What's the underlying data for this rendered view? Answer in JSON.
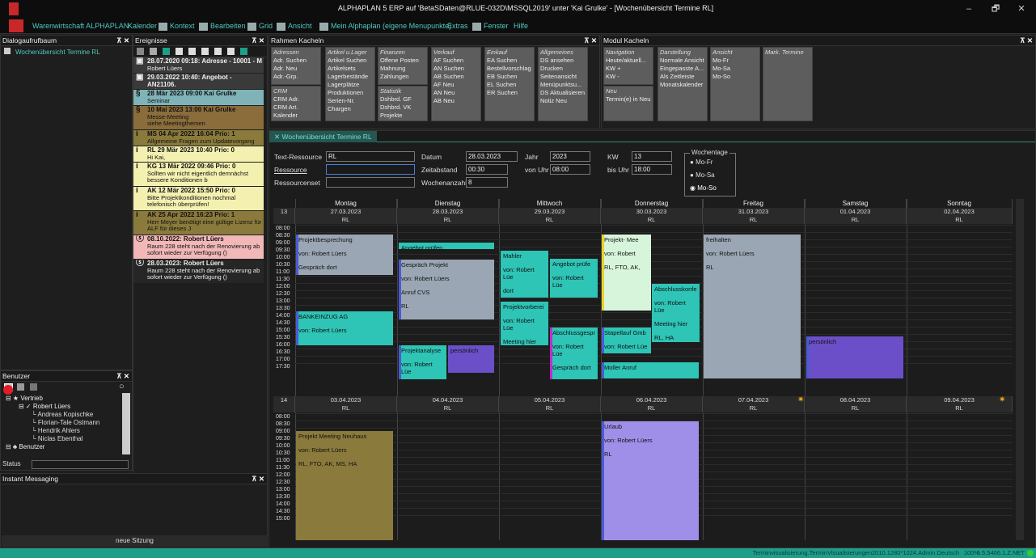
{
  "window": {
    "title": "ALPHAPLAN 5 ERP auf 'BetaSDaten@RLUE-032D\\MSSQL2019' unter 'Kai Grulke' - [Wochenübersicht Termine RL]",
    "minimize": "–",
    "restore": "🗗",
    "close": "✕"
  },
  "menu": [
    "Warenwirtschaft ALPHAPLAN",
    "Kalender",
    "Kontext",
    "Bearbeiten",
    "Grid",
    "Ansicht",
    "Mein Alphaplan (eigene Menupunkte)",
    "Extras",
    "Fenster",
    "Hilfe"
  ],
  "dialog_panel": {
    "title": "Dialogaufrufbaum",
    "item": "Wochenübersicht Termine RL"
  },
  "events_panel": {
    "title": "Ereignisse",
    "items": [
      {
        "head": "28.07.2020 09:18: Adresse - 10001 - M",
        "sub": "Robert Lüers",
        "color": "#3a3a3a",
        "text": "#eee",
        "icon": "▣"
      },
      {
        "head": "29.03.2022 10:40: Angebot - AN21106.",
        "sub": "Robert Lüers",
        "color": "#3a3a3a",
        "text": "#eee",
        "icon": "▣"
      },
      {
        "head": "28 Mär 2023  09:00 Kai Grulke",
        "sub": "Seminar",
        "color": "#7fb3b8",
        "text": "#111",
        "icon": "§"
      },
      {
        "head": "10 Mai 2023  13:00 Kai Grulke",
        "sub": "Messe-Meeting\nsiehe Meetingthemen",
        "color": "#8a6d3b",
        "text": "#111",
        "icon": "§"
      },
      {
        "head": "MS 04 Apr 2022 16:04 Prio: 1",
        "sub": "Allgemeine Fragen zum Updatevorgang",
        "color": "#8a7a3b",
        "text": "#111",
        "icon": "i"
      },
      {
        "head": "RL 29 Mär 2023 10:40 Prio: 0",
        "sub": "Hi Kai,\nist das Angebot fertig?",
        "color": "#f4f0b0",
        "text": "#111",
        "icon": "i"
      },
      {
        "head": "KG 13 Mär 2022 09:46 Prio: 0",
        "sub": "Sollten wir nicht eigentlich demnächst\nbessere Konditionen b",
        "color": "#f4f0b0",
        "text": "#111",
        "icon": "i"
      },
      {
        "head": "AK 12 Mär 2022 15:50 Prio: 0",
        "sub": "Bitte Projektkonditionen nochmal\ntelefonisch überprüfen!",
        "color": "#f4f0b0",
        "text": "#111",
        "icon": "i"
      },
      {
        "head": "AK 25 Apr 2022 16:23 Prio: 1",
        "sub": "Herr Meyer benötigt eine gültige Lizenz für\nALF für dieses J",
        "color": "#8a7a3b",
        "text": "#111",
        "icon": "i"
      },
      {
        "head": "08.10.2022: Robert Lüers",
        "sub": "Raum 228 steht nach der Renovierung ab\nsofort wieder zur Verfügung ()",
        "color": "#f2b8b8",
        "text": "#111",
        "icon": "ⓢ"
      },
      {
        "head": "28.03.2023: Robert Lüers",
        "sub": "Raum 228 steht nach der Renovierung ab\nsofort wieder zur Verfügung ()",
        "color": "#262626",
        "text": "#eee",
        "icon": "ⓢ"
      }
    ]
  },
  "users_panel": {
    "title": "Benutzer",
    "group1": "Vertrieb",
    "users": [
      "Robert Lüers",
      "Andreas Kopischke",
      "Florian-Tale Ostmann",
      "Hendrik Ahlers",
      "Niclas Ebenthal"
    ],
    "group2": "Benutzer",
    "status_label": "Status"
  },
  "im_panel": {
    "title": "Instant Messaging",
    "button": "neue Sitzung"
  },
  "rahmen": {
    "title": "Rahmen Kacheln",
    "tiles": [
      {
        "h": "Adressen",
        "lines": [
          "Adr. Suchen",
          "Adr. Neu",
          "Adr.-Grp."
        ]
      },
      {
        "h": "Artikel u.Lager",
        "lines": [
          "Artikel Suchen",
          "Artikelsets",
          "Lagerbestände",
          "Lagerplätze",
          "Produktionen",
          "Serien-Nr.",
          "Chargen"
        ]
      },
      {
        "h": "Finanzen",
        "lines": [
          "Offene Posten",
          "Mahnung",
          "Zahlungen"
        ]
      },
      {
        "h": "Verkauf",
        "lines": [
          "AF Suchen",
          "AN Suchen",
          "AB Suchen",
          "",
          "AF Neu",
          "AN Neu",
          "AB Neu"
        ]
      },
      {
        "h": "Einkauf",
        "lines": [
          "EA Suchen",
          "Bestellvorschlag",
          "EB Suchen",
          "EL Suchen",
          "ER Suchen"
        ]
      },
      {
        "h": "Allgemeines",
        "lines": [
          "DS ansehen",
          "Drucken",
          "Seitenansicht",
          "Menüpunktsu...",
          "DS Aktualisieren",
          "Notiz Neu"
        ]
      },
      {
        "h": "CRM",
        "lines": [
          "CRM Adr.",
          "CRM Art.",
          "Kalender"
        ]
      },
      {
        "h": "Statistik",
        "lines": [
          "Dshbrd. GF",
          "Dshbrd. VK",
          "Projekte"
        ]
      }
    ]
  },
  "modul": {
    "title": "Modul Kacheln",
    "tiles": [
      {
        "h": "Navigation",
        "lines": [
          "Heute/aktuell...",
          "KW +",
          "KW -"
        ]
      },
      {
        "h": "Neu",
        "lines": [
          "Termin(e) in Neu"
        ]
      },
      {
        "h": "Darstellung",
        "lines": [
          "Normale Ansicht",
          "Eingepasste A...",
          "Als Zeitleiste",
          "Monatskalender"
        ]
      },
      {
        "h": "Ansicht",
        "lines": [
          "Mo-Fr",
          "Mo-Sa",
          "Mo-So"
        ]
      },
      {
        "h": "Mark. Termine",
        "lines": []
      }
    ]
  },
  "calendar": {
    "tab": "Wochenübersicht Termine RL",
    "filters": {
      "text_ressource_label": "Text-Ressource",
      "text_ressource_value": "RL",
      "ressource_label": "Ressource",
      "ressourcenset_label": "Ressourcenset",
      "datum_label": "Datum",
      "datum_value": "28.03.2023",
      "zeitabstand_label": "Zeitabstand",
      "zeitabstand_value": "00:30",
      "wochenanzahl_label": "Wochenanzahl",
      "wochenanzahl_value": "8",
      "jahr_label": "Jahr",
      "jahr_value": "2023",
      "von_uhr_label": "von Uhr",
      "von_uhr_value": "08:00",
      "kw_label": "KW",
      "kw_value": "13",
      "bis_uhr_label": "bis Uhr",
      "bis_uhr_value": "18:00",
      "wochentage_label": "Wochentage",
      "wochentage_options": [
        "Mo-Fr",
        "Mo-Sa",
        "Mo-So"
      ],
      "wochentage_selected": "Mo-So"
    },
    "days": [
      "Montag",
      "Dienstag",
      "Mittwoch",
      "Donnerstag",
      "Freitag",
      "Samstag",
      "Sonntag"
    ],
    "week1": {
      "kw": "13",
      "dates": [
        "27.03.2023",
        "28.03.2023",
        "29.03.2023",
        "30.03.2023",
        "31.03.2023",
        "01.04.2023",
        "02.04.2023"
      ],
      "res": "RL"
    },
    "week2": {
      "kw": "14",
      "dates": [
        "03.04.2023",
        "04.04.2023",
        "05.04.2023",
        "06.04.2023",
        "07.04.2023",
        "08.04.2023",
        "09.04.2023"
      ],
      "res": "RL"
    },
    "times1": [
      "08:00",
      "08:30",
      "09:00",
      "09:30",
      "10:00",
      "10:30",
      "11:00",
      "11:30",
      "12:00",
      "12:30",
      "13:00",
      "13:30",
      "14:00",
      "14:30",
      "15:00",
      "15:30",
      "16:00",
      "16:30",
      "17:00",
      "17:30"
    ],
    "times2": [
      "08:00",
      "08:30",
      "09:00",
      "09:30",
      "10:00",
      "10:30",
      "11:00",
      "11:30",
      "12:00",
      "12:30",
      "13:00",
      "13:30",
      "14:00",
      "14:30",
      "15:00"
    ]
  },
  "appointments": [
    {
      "t": "Projektbesprechung",
      "l": [
        "von: Robert Lüers",
        "Gespräch dort"
      ],
      "c": "#9aa6b4",
      "b": "#4a5bd6"
    },
    {
      "t": "Angebot prüfen",
      "l": [],
      "c": "#2ec4b6",
      "b": "#2ec4b6"
    },
    {
      "t": "Gespräch Projekt",
      "l": [
        "von: Robert Lüers",
        "Anruf CVS",
        "RL"
      ],
      "c": "#9aa6b4",
      "b": "#4a5bd6"
    },
    {
      "t": "BANKEINZUG AG",
      "l": [
        "von: Robert Lüers"
      ],
      "c": "#2ec4b6",
      "b": "#4a5bd6"
    },
    {
      "t": "Projektanalyse",
      "l": [
        "von: Robert Lüe"
      ],
      "c": "#2ec4b6",
      "b": "#4a5bd6"
    },
    {
      "t": "persönlich",
      "l": [],
      "c": "#6a4fc8",
      "b": "#6a4fc8"
    },
    {
      "t": "Mahler",
      "l": [
        "von: Robert Lüe",
        "dort"
      ],
      "c": "#2ec4b6",
      "b": "#2ec4b6"
    },
    {
      "t": "Angebot prüfe",
      "l": [
        "von: Robert Lüe"
      ],
      "c": "#2ec4b6",
      "b": "#2ec4b6"
    },
    {
      "t": "Projektvorberei",
      "l": [
        "von: Robert Lüe",
        "Meeting hier"
      ],
      "c": "#2ec4b6",
      "b": "#2ec4b6"
    },
    {
      "t": "Abschlussgespr",
      "l": [
        "von: Robert Lüe",
        "Gespräch dort",
        "RL, AK"
      ],
      "c": "#2ec4b6",
      "b": "#c02ad0"
    },
    {
      "t": "Projekt- Mee",
      "l": [
        "von: Robert",
        "RL, FTO, AK,"
      ],
      "c": "#d7f5da",
      "b": "#e8d22a"
    },
    {
      "t": "Abschlusskonfe",
      "l": [
        "von: Robert Lüe",
        "Meeting hier",
        "RL, HA"
      ],
      "c": "#2ec4b6",
      "b": "#2ec4b6"
    },
    {
      "t": "Stapellauf Gmb",
      "l": [
        "von: Robert Lüe"
      ],
      "c": "#2ec4b6",
      "b": "#4a5bd6"
    },
    {
      "t": "Moller Anruf",
      "l": [],
      "c": "#2ec4b6",
      "b": "#4a5bd6"
    },
    {
      "t": "freihalten",
      "l": [
        "von: Robert Lüers",
        "RL"
      ],
      "c": "#9aa6b4",
      "b": "#9aa6b4"
    },
    {
      "t": "persönlich",
      "l": [],
      "c": "#6a4fc8",
      "b": "#4a5bd6"
    },
    {
      "t": "Projekt Meeting Neuhaus",
      "l": [
        "von: Robert Lüers",
        "RL, FTO, AK, MS, HA"
      ],
      "c": "#8a7a3b",
      "b": "#8a7a3b"
    },
    {
      "t": "Urlaub",
      "l": [
        "von: Robert Lüers",
        "RL"
      ],
      "c": "#a08fe8",
      "b": "#4a5bd6"
    }
  ],
  "statusbar": {
    "text": "Terminvisualisierung.TerminVisualisierungen2010.1280*1024.Admin.Deutsch",
    "zoom": "100%",
    "version": "5.5.5406.1.Z.NET"
  }
}
